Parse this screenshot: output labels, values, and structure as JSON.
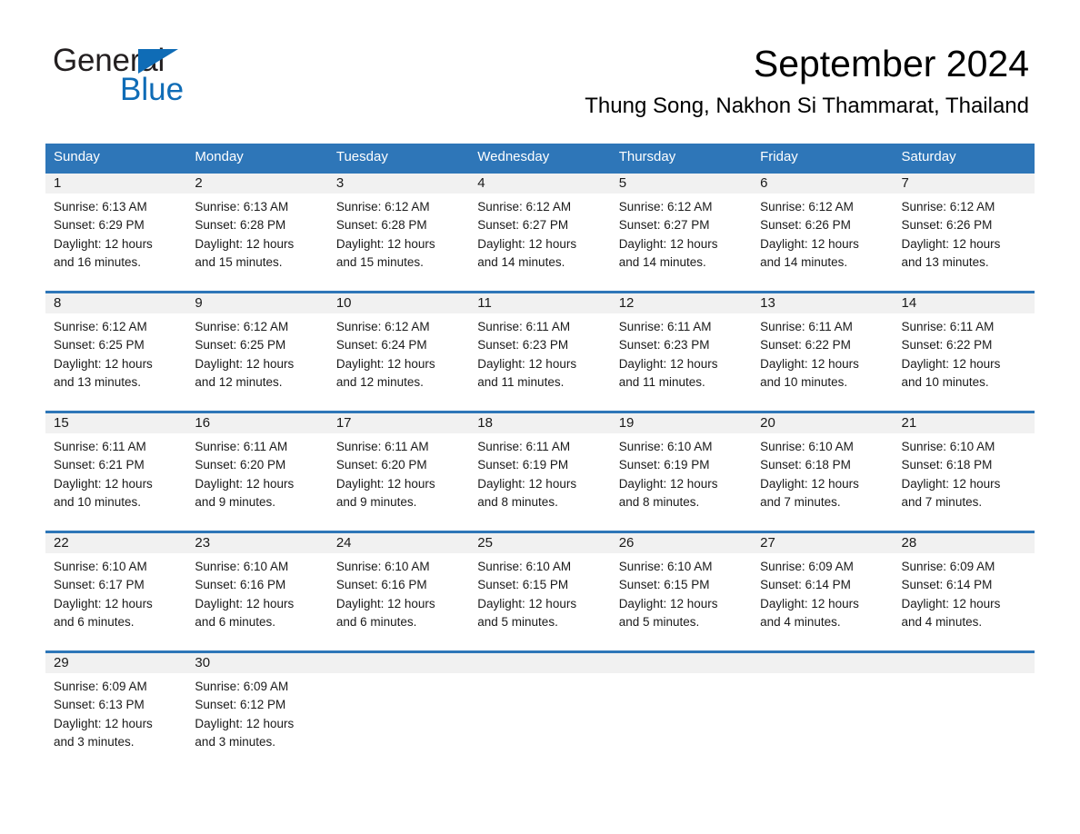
{
  "brand": {
    "name_part1": "General",
    "name_part2": "Blue",
    "flag_icon": "triangle-flag-icon",
    "accent_color": "#0f6cb6"
  },
  "header": {
    "month_title": "September 2024",
    "location": "Thung Song, Nakhon Si Thammarat, Thailand"
  },
  "theme": {
    "header_blue": "#2e76b8",
    "row_band_gray": "#f1f1f1",
    "text_color": "#1a1a1a"
  },
  "weekdays": [
    "Sunday",
    "Monday",
    "Tuesday",
    "Wednesday",
    "Thursday",
    "Friday",
    "Saturday"
  ],
  "weeks": [
    [
      {
        "day": "1",
        "sunrise": "Sunrise: 6:13 AM",
        "sunset": "Sunset: 6:29 PM",
        "daylight_line1": "Daylight: 12 hours",
        "daylight_line2": "and 16 minutes."
      },
      {
        "day": "2",
        "sunrise": "Sunrise: 6:13 AM",
        "sunset": "Sunset: 6:28 PM",
        "daylight_line1": "Daylight: 12 hours",
        "daylight_line2": "and 15 minutes."
      },
      {
        "day": "3",
        "sunrise": "Sunrise: 6:12 AM",
        "sunset": "Sunset: 6:28 PM",
        "daylight_line1": "Daylight: 12 hours",
        "daylight_line2": "and 15 minutes."
      },
      {
        "day": "4",
        "sunrise": "Sunrise: 6:12 AM",
        "sunset": "Sunset: 6:27 PM",
        "daylight_line1": "Daylight: 12 hours",
        "daylight_line2": "and 14 minutes."
      },
      {
        "day": "5",
        "sunrise": "Sunrise: 6:12 AM",
        "sunset": "Sunset: 6:27 PM",
        "daylight_line1": "Daylight: 12 hours",
        "daylight_line2": "and 14 minutes."
      },
      {
        "day": "6",
        "sunrise": "Sunrise: 6:12 AM",
        "sunset": "Sunset: 6:26 PM",
        "daylight_line1": "Daylight: 12 hours",
        "daylight_line2": "and 14 minutes."
      },
      {
        "day": "7",
        "sunrise": "Sunrise: 6:12 AM",
        "sunset": "Sunset: 6:26 PM",
        "daylight_line1": "Daylight: 12 hours",
        "daylight_line2": "and 13 minutes."
      }
    ],
    [
      {
        "day": "8",
        "sunrise": "Sunrise: 6:12 AM",
        "sunset": "Sunset: 6:25 PM",
        "daylight_line1": "Daylight: 12 hours",
        "daylight_line2": "and 13 minutes."
      },
      {
        "day": "9",
        "sunrise": "Sunrise: 6:12 AM",
        "sunset": "Sunset: 6:25 PM",
        "daylight_line1": "Daylight: 12 hours",
        "daylight_line2": "and 12 minutes."
      },
      {
        "day": "10",
        "sunrise": "Sunrise: 6:12 AM",
        "sunset": "Sunset: 6:24 PM",
        "daylight_line1": "Daylight: 12 hours",
        "daylight_line2": "and 12 minutes."
      },
      {
        "day": "11",
        "sunrise": "Sunrise: 6:11 AM",
        "sunset": "Sunset: 6:23 PM",
        "daylight_line1": "Daylight: 12 hours",
        "daylight_line2": "and 11 minutes."
      },
      {
        "day": "12",
        "sunrise": "Sunrise: 6:11 AM",
        "sunset": "Sunset: 6:23 PM",
        "daylight_line1": "Daylight: 12 hours",
        "daylight_line2": "and 11 minutes."
      },
      {
        "day": "13",
        "sunrise": "Sunrise: 6:11 AM",
        "sunset": "Sunset: 6:22 PM",
        "daylight_line1": "Daylight: 12 hours",
        "daylight_line2": "and 10 minutes."
      },
      {
        "day": "14",
        "sunrise": "Sunrise: 6:11 AM",
        "sunset": "Sunset: 6:22 PM",
        "daylight_line1": "Daylight: 12 hours",
        "daylight_line2": "and 10 minutes."
      }
    ],
    [
      {
        "day": "15",
        "sunrise": "Sunrise: 6:11 AM",
        "sunset": "Sunset: 6:21 PM",
        "daylight_line1": "Daylight: 12 hours",
        "daylight_line2": "and 10 minutes."
      },
      {
        "day": "16",
        "sunrise": "Sunrise: 6:11 AM",
        "sunset": "Sunset: 6:20 PM",
        "daylight_line1": "Daylight: 12 hours",
        "daylight_line2": "and 9 minutes."
      },
      {
        "day": "17",
        "sunrise": "Sunrise: 6:11 AM",
        "sunset": "Sunset: 6:20 PM",
        "daylight_line1": "Daylight: 12 hours",
        "daylight_line2": "and 9 minutes."
      },
      {
        "day": "18",
        "sunrise": "Sunrise: 6:11 AM",
        "sunset": "Sunset: 6:19 PM",
        "daylight_line1": "Daylight: 12 hours",
        "daylight_line2": "and 8 minutes."
      },
      {
        "day": "19",
        "sunrise": "Sunrise: 6:10 AM",
        "sunset": "Sunset: 6:19 PM",
        "daylight_line1": "Daylight: 12 hours",
        "daylight_line2": "and 8 minutes."
      },
      {
        "day": "20",
        "sunrise": "Sunrise: 6:10 AM",
        "sunset": "Sunset: 6:18 PM",
        "daylight_line1": "Daylight: 12 hours",
        "daylight_line2": "and 7 minutes."
      },
      {
        "day": "21",
        "sunrise": "Sunrise: 6:10 AM",
        "sunset": "Sunset: 6:18 PM",
        "daylight_line1": "Daylight: 12 hours",
        "daylight_line2": "and 7 minutes."
      }
    ],
    [
      {
        "day": "22",
        "sunrise": "Sunrise: 6:10 AM",
        "sunset": "Sunset: 6:17 PM",
        "daylight_line1": "Daylight: 12 hours",
        "daylight_line2": "and 6 minutes."
      },
      {
        "day": "23",
        "sunrise": "Sunrise: 6:10 AM",
        "sunset": "Sunset: 6:16 PM",
        "daylight_line1": "Daylight: 12 hours",
        "daylight_line2": "and 6 minutes."
      },
      {
        "day": "24",
        "sunrise": "Sunrise: 6:10 AM",
        "sunset": "Sunset: 6:16 PM",
        "daylight_line1": "Daylight: 12 hours",
        "daylight_line2": "and 6 minutes."
      },
      {
        "day": "25",
        "sunrise": "Sunrise: 6:10 AM",
        "sunset": "Sunset: 6:15 PM",
        "daylight_line1": "Daylight: 12 hours",
        "daylight_line2": "and 5 minutes."
      },
      {
        "day": "26",
        "sunrise": "Sunrise: 6:10 AM",
        "sunset": "Sunset: 6:15 PM",
        "daylight_line1": "Daylight: 12 hours",
        "daylight_line2": "and 5 minutes."
      },
      {
        "day": "27",
        "sunrise": "Sunrise: 6:09 AM",
        "sunset": "Sunset: 6:14 PM",
        "daylight_line1": "Daylight: 12 hours",
        "daylight_line2": "and 4 minutes."
      },
      {
        "day": "28",
        "sunrise": "Sunrise: 6:09 AM",
        "sunset": "Sunset: 6:14 PM",
        "daylight_line1": "Daylight: 12 hours",
        "daylight_line2": "and 4 minutes."
      }
    ],
    [
      {
        "day": "29",
        "sunrise": "Sunrise: 6:09 AM",
        "sunset": "Sunset: 6:13 PM",
        "daylight_line1": "Daylight: 12 hours",
        "daylight_line2": "and 3 minutes."
      },
      {
        "day": "30",
        "sunrise": "Sunrise: 6:09 AM",
        "sunset": "Sunset: 6:12 PM",
        "daylight_line1": "Daylight: 12 hours",
        "daylight_line2": "and 3 minutes."
      },
      {
        "day": "",
        "sunrise": "",
        "sunset": "",
        "daylight_line1": "",
        "daylight_line2": ""
      },
      {
        "day": "",
        "sunrise": "",
        "sunset": "",
        "daylight_line1": "",
        "daylight_line2": ""
      },
      {
        "day": "",
        "sunrise": "",
        "sunset": "",
        "daylight_line1": "",
        "daylight_line2": ""
      },
      {
        "day": "",
        "sunrise": "",
        "sunset": "",
        "daylight_line1": "",
        "daylight_line2": ""
      },
      {
        "day": "",
        "sunrise": "",
        "sunset": "",
        "daylight_line1": "",
        "daylight_line2": ""
      }
    ]
  ]
}
